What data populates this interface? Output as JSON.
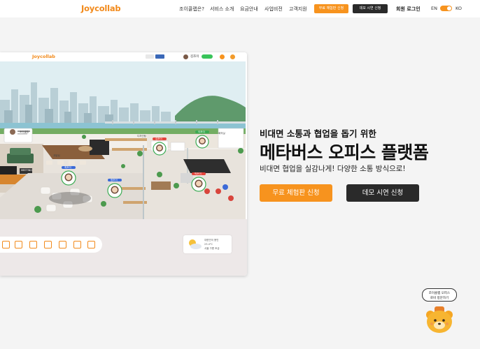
{
  "nav": {
    "logo": "Joycollab",
    "links": [
      "조이콜랩은?",
      "서비스 소개",
      "요금안내",
      "사업비전",
      "고객지원"
    ],
    "trial_button": "무료 체험판 신청",
    "demo_button": "데모 시연 신청",
    "login": "회원 로그인",
    "lang_en": "EN",
    "lang_ko": "KO"
  },
  "mockup": {
    "logo": "Joycollab",
    "user_name": "김조이",
    "scene_labels": [
      "조이콜랩",
      "MEETING",
      "개발팀",
      "디자인팀",
      "회의실",
      "김조이",
      "이조이",
      "박조이",
      "최조이",
      "정조이"
    ],
    "weather_lines": [
      "대한민국 용인",
      "23.4°C",
      "서울 구름 조금"
    ]
  },
  "hero": {
    "subtitle": "비대면 소통과 협업을 돕기 위한",
    "title": "메타버스 오피스 플랫폼",
    "tagline": "비대면 협업을 실감나게!  다양한 소통 방식으로!",
    "trial_button": "무료 체험판 신청",
    "demo_button": "데모 시연 신청"
  },
  "mascot": {
    "bubble_line1": "조이콜랩 오피스",
    "bubble_line2": "로비 방문하기"
  },
  "colors": {
    "brand_orange": "#f7931e",
    "dark_button": "#2a2a2a",
    "online_green": "#39c45a"
  }
}
